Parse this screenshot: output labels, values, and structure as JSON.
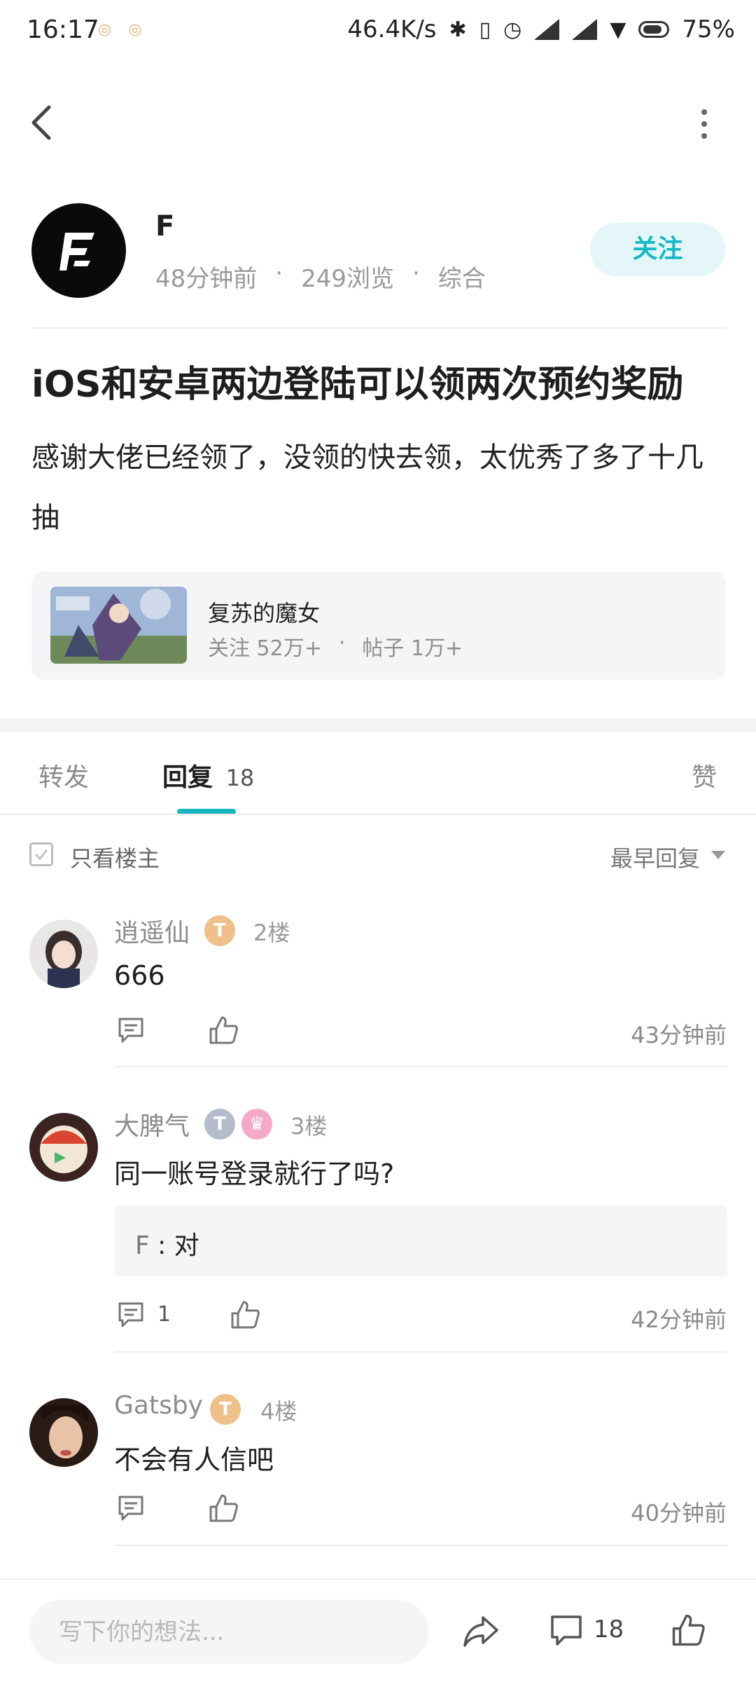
{
  "status_bar": {
    "time": "16:17",
    "net_speed": "46.4K/s",
    "battery": "75%"
  },
  "post": {
    "author": "F",
    "time_ago": "48分钟前",
    "views": "249浏览",
    "category": "综合",
    "follow_label": "关注",
    "title": "iOS和安卓两边登陆可以领两次预约奖励",
    "body": "感谢大佬已经领了，没领的快去领，太优秀了多了十几抽"
  },
  "game_card": {
    "name": "复苏的魔女",
    "followers": "关注  52万+",
    "posts": "帖子  1万+"
  },
  "tabs": {
    "repost": "转发",
    "reply": "回复",
    "reply_count": "18",
    "like": "赞"
  },
  "filter": {
    "only_op": "只看楼主",
    "sort": "最早回复"
  },
  "comments": [
    {
      "name": "逍遥仙",
      "badge": "T",
      "floor": "2楼",
      "text": "666",
      "time": "43分钟前"
    },
    {
      "name": "大脾气",
      "badge": "T",
      "floor": "3楼",
      "text": "同一账号登录就行了吗?",
      "reply_author": "F",
      "reply_text": "对",
      "reply_count": "1",
      "time": "42分钟前"
    },
    {
      "name": "Gatsby",
      "badge": "T",
      "floor": "4楼",
      "text": "不会有人信吧",
      "time": "40分钟前"
    }
  ],
  "bottom_bar": {
    "input_placeholder": "写下你的想法...",
    "comment_count": "18"
  },
  "colors": {
    "accent": "#19b6c2",
    "follow_bg": "#e4f6f7",
    "card_bg": "#f3f5f7"
  }
}
